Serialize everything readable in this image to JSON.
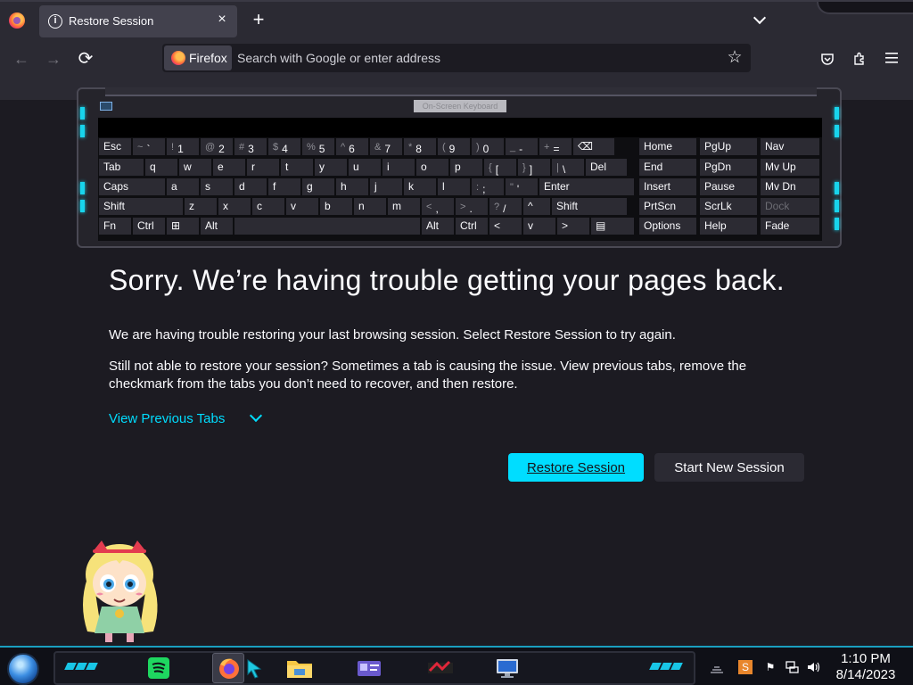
{
  "tab": {
    "title": "Restore Session",
    "close": "×",
    "new_tab": "+"
  },
  "nav": {
    "back": "←",
    "forward": "→",
    "reload": "⟳",
    "identity_label": "Firefox",
    "url_placeholder": "Search with Google or enter address",
    "star": "☆"
  },
  "osk": {
    "title": "On-Screen Keyboard",
    "rows": [
      [
        {
          "k": "Esc"
        },
        {
          "s": "~",
          "k": "`"
        },
        {
          "s": "!",
          "k": "1"
        },
        {
          "s": "@",
          "k": "2"
        },
        {
          "s": "#",
          "k": "3"
        },
        {
          "s": "$",
          "k": "4"
        },
        {
          "s": "%",
          "k": "5"
        },
        {
          "s": "^",
          "k": "6"
        },
        {
          "s": "&",
          "k": "7"
        },
        {
          "s": "*",
          "k": "8"
        },
        {
          "s": "(",
          "k": "9"
        },
        {
          "s": ")",
          "k": "0"
        },
        {
          "s": "_",
          "k": "-"
        },
        {
          "s": "+",
          "k": "="
        },
        {
          "k": "⌫"
        }
      ],
      [
        {
          "k": "Tab"
        },
        {
          "k": "q"
        },
        {
          "k": "w"
        },
        {
          "k": "e"
        },
        {
          "k": "r"
        },
        {
          "k": "t"
        },
        {
          "k": "y"
        },
        {
          "k": "u"
        },
        {
          "k": "i"
        },
        {
          "k": "o"
        },
        {
          "k": "p"
        },
        {
          "s": "{",
          "k": "["
        },
        {
          "s": "}",
          "k": "]"
        },
        {
          "s": "|",
          "k": "\\"
        },
        {
          "k": "Del"
        }
      ],
      [
        {
          "k": "Caps"
        },
        {
          "k": "a"
        },
        {
          "k": "s"
        },
        {
          "k": "d"
        },
        {
          "k": "f"
        },
        {
          "k": "g"
        },
        {
          "k": "h"
        },
        {
          "k": "j"
        },
        {
          "k": "k"
        },
        {
          "k": "l"
        },
        {
          "s": ":",
          "k": ";"
        },
        {
          "s": "\"",
          "k": "'"
        },
        {
          "k": "Enter"
        }
      ],
      [
        {
          "k": "Shift"
        },
        {
          "k": "z"
        },
        {
          "k": "x"
        },
        {
          "k": "c"
        },
        {
          "k": "v"
        },
        {
          "k": "b"
        },
        {
          "k": "n"
        },
        {
          "k": "m"
        },
        {
          "s": "<",
          "k": ","
        },
        {
          "s": ">",
          "k": "."
        },
        {
          "s": "?",
          "k": "/"
        },
        {
          "k": "^"
        },
        {
          "k": "Shift"
        }
      ],
      [
        {
          "k": "Fn"
        },
        {
          "k": "Ctrl"
        },
        {
          "k": "⊞"
        },
        {
          "k": "Alt"
        },
        {
          "k": ""
        },
        {
          "k": "Alt"
        },
        {
          "k": "Ctrl"
        },
        {
          "k": "<"
        },
        {
          "k": "v"
        },
        {
          "k": ">"
        },
        {
          "k": "▤"
        }
      ]
    ],
    "nav_keys": [
      [
        "Home",
        "PgUp",
        "Nav"
      ],
      [
        "End",
        "PgDn",
        "Mv Up"
      ],
      [
        "Insert",
        "Pause",
        "Mv Dn"
      ],
      [
        "PrtScn",
        "ScrLk",
        "Dock"
      ],
      [
        "Options",
        "Help",
        "Fade"
      ]
    ]
  },
  "page": {
    "title": "Sorry. We’re having trouble getting your pages back.",
    "para1": "We are having trouble restoring your last browsing session. Select Restore Session to try again.",
    "para2": "Still not able to restore your session? Sometimes a tab is causing the issue. View previous tabs, remove the checkmark from the tabs you don’t need to recover, and then restore.",
    "view_previous_tabs": "View Previous Tabs",
    "restore_button": "Restore Session",
    "new_session_button": "Start New Session"
  },
  "taskbar": {
    "apps": [
      "spotify-icon",
      "firefox-icon",
      "file-explorer-icon",
      "id-card-icon",
      "dj-app-icon",
      "remote-desktop-icon"
    ],
    "time": "1:10 PM",
    "date": "8/14/2023"
  },
  "colors": {
    "accent": "#00ddff",
    "bg": "#1c1b22",
    "toolbar": "#2b2a33",
    "cyan_deco": "#18d4ec"
  }
}
